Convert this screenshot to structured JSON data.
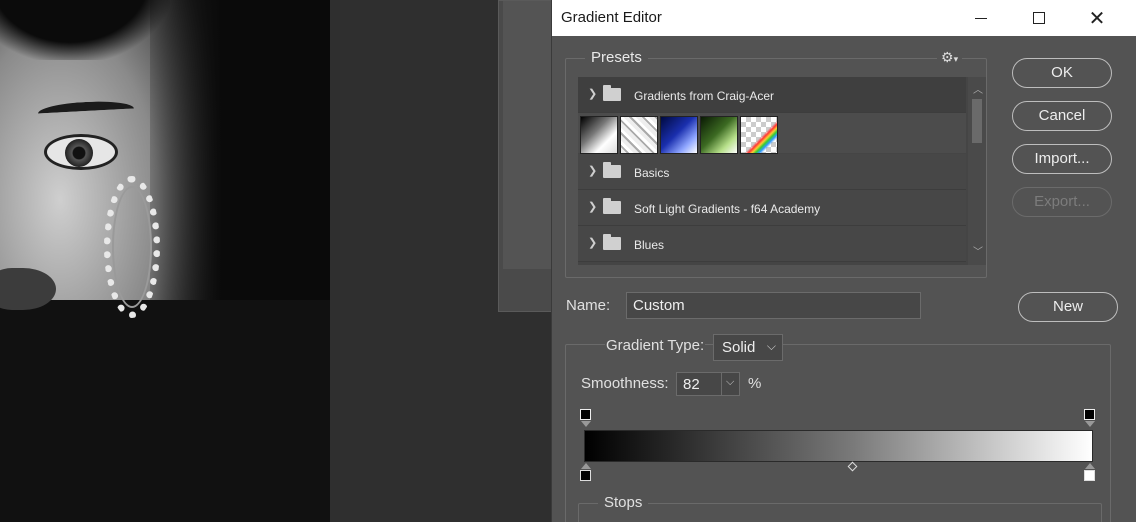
{
  "dialog": {
    "title": "Gradient Editor",
    "window_controls": {
      "minimize_icon": "minimize-icon",
      "maximize_icon": "maximize-icon",
      "close_icon": "close-icon"
    }
  },
  "presets": {
    "label": "Presets",
    "settings_icon": "gear-icon",
    "items": [
      {
        "label": "Gradients from Craig-Acer",
        "expanded": true,
        "swatch_count": 5
      },
      {
        "label": "Basics",
        "expanded": false
      },
      {
        "label": "Soft Light Gradients - f64 Academy",
        "expanded": false
      },
      {
        "label": "Blues",
        "expanded": false
      }
    ]
  },
  "buttons": {
    "ok": "OK",
    "cancel": "Cancel",
    "import": "Import...",
    "export": "Export...",
    "new": "New"
  },
  "name": {
    "label": "Name:",
    "value": "Custom"
  },
  "gradient_type": {
    "label": "Gradient Type:",
    "value": "Solid"
  },
  "smoothness": {
    "label": "Smoothness:",
    "value": "82",
    "unit": "%"
  },
  "gradient": {
    "colors": [
      "#000000",
      "#ffffff"
    ],
    "midpoint_percent": 53
  },
  "stops": {
    "label": "Stops"
  }
}
